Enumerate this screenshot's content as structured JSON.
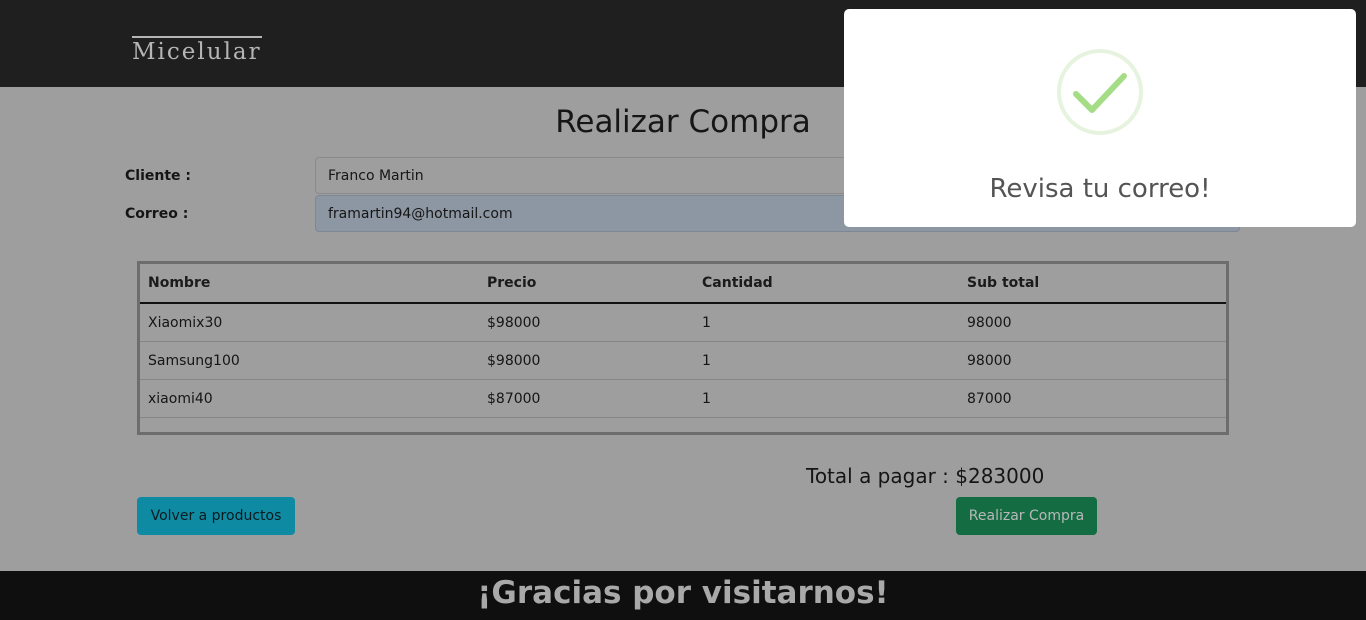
{
  "header": {
    "brand": "Micelular"
  },
  "page": {
    "title": "Realizar Compra"
  },
  "form": {
    "cliente_label": "Cliente :",
    "cliente_value": "Franco Martin",
    "correo_label": "Correo :",
    "correo_value": "framartin94@hotmail.com"
  },
  "table": {
    "headers": [
      "Nombre",
      "Precio",
      "Cantidad",
      "Sub total"
    ],
    "rows": [
      [
        "Xiaomix30",
        "$98000",
        "1",
        "98000"
      ],
      [
        "Samsung100",
        "$98000",
        "1",
        "98000"
      ],
      [
        "xiaomi40",
        "$87000",
        "1",
        "87000"
      ]
    ]
  },
  "summary": {
    "total_label": "Total a pagar : $283000"
  },
  "buttons": {
    "back": "Volver a productos",
    "buy": "Realizar Compra"
  },
  "footer": {
    "text": "¡Gracias por visitarnos!"
  },
  "alert": {
    "title": "Revisa tu correo!",
    "icon": "success-check-icon"
  },
  "colors": {
    "navbar": "#1f1f1f",
    "overlay_bg": "#9e9e9e",
    "info_button": "#0f8aa3",
    "success_button": "#146c43",
    "check": "#a5dc86"
  }
}
